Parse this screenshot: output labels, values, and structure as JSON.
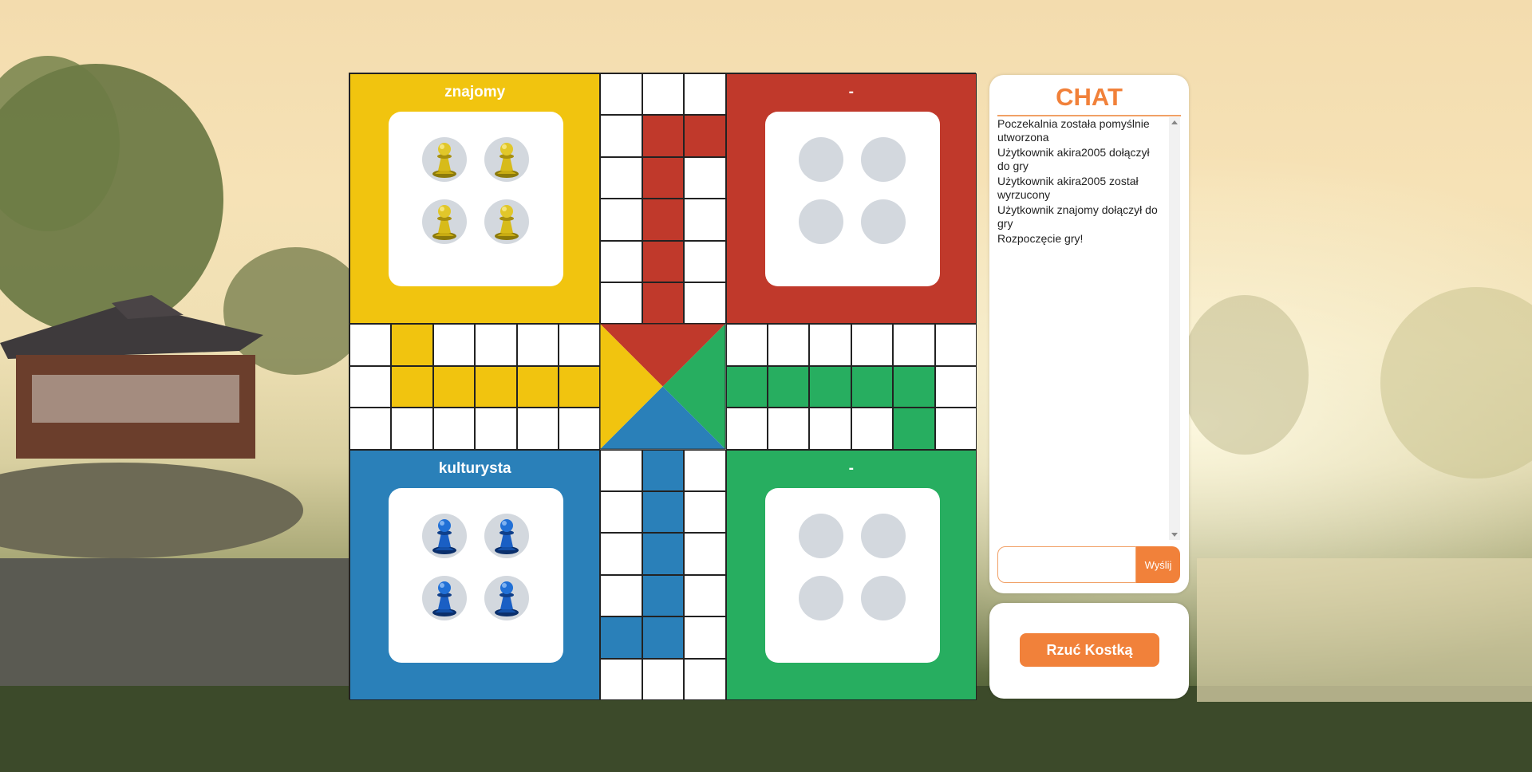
{
  "theme": {
    "yellow": "#f1c40f",
    "red": "#c0392b",
    "blue": "#2a80b9",
    "green": "#27ae60",
    "accent": "#f1813a",
    "slot": "#d3d8de"
  },
  "players": {
    "yellow": {
      "name": "znajomy",
      "pawns_in_home": 4
    },
    "red": {
      "name": "-",
      "pawns_in_home": 0
    },
    "blue": {
      "name": "kulturysta",
      "pawns_in_home": 4
    },
    "green": {
      "name": "-",
      "pawns_in_home": 0
    }
  },
  "chat": {
    "title": "CHAT",
    "messages": [
      "Poczekalnia została pomyślnie utworzona",
      "Użytkownik akira2005 dołączył do gry",
      "Użytkownik akira2005 został wyrzucony",
      "Użytkownik znajomy dołączył do gry",
      "Rozpoczęcie gry!"
    ],
    "input_value": "",
    "send_label": "Wyślij"
  },
  "dice": {
    "roll_label": "Rzuć Kostką"
  }
}
